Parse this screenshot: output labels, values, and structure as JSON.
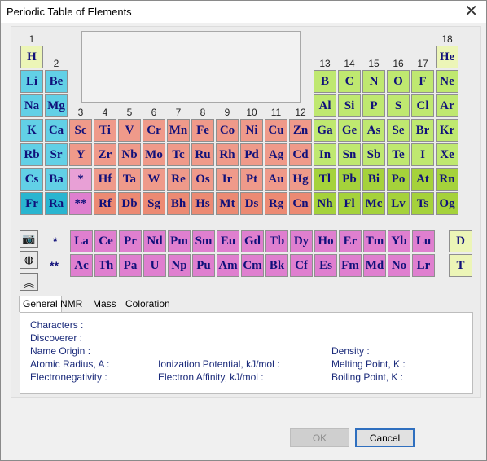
{
  "window": {
    "title": "Periodic Table of Elements",
    "close_symbol": "✕"
  },
  "colors": {
    "alkali": "#62d0e6",
    "alkali_dark": "#29b5d0",
    "transition": "#ef9a8a",
    "transition_dark": "#ec8a73",
    "main_group": "#bfe870",
    "main_group_dark": "#a5d23b",
    "s_edge": "#ecf5b7",
    "f_block": "#df7fcf",
    "f_marker": "#e8a0d6",
    "d_noble": "#ecf5b7"
  },
  "group_labels": [
    "1",
    "2",
    "3",
    "4",
    "5",
    "6",
    "7",
    "8",
    "9",
    "10",
    "11",
    "12",
    "13",
    "14",
    "15",
    "16",
    "17",
    "18"
  ],
  "elements": [
    {
      "sym": "H",
      "col": 1,
      "row": 1,
      "cls": "s_edge"
    },
    {
      "sym": "He",
      "col": 18,
      "row": 1,
      "cls": "s_edge"
    },
    {
      "sym": "Li",
      "col": 1,
      "row": 2,
      "cls": "alkali"
    },
    {
      "sym": "Be",
      "col": 2,
      "row": 2,
      "cls": "alkali"
    },
    {
      "sym": "B",
      "col": 13,
      "row": 2,
      "cls": "main_group"
    },
    {
      "sym": "C",
      "col": 14,
      "row": 2,
      "cls": "main_group"
    },
    {
      "sym": "N",
      "col": 15,
      "row": 2,
      "cls": "main_group"
    },
    {
      "sym": "O",
      "col": 16,
      "row": 2,
      "cls": "main_group"
    },
    {
      "sym": "F",
      "col": 17,
      "row": 2,
      "cls": "main_group"
    },
    {
      "sym": "Ne",
      "col": 18,
      "row": 2,
      "cls": "main_group"
    },
    {
      "sym": "Na",
      "col": 1,
      "row": 3,
      "cls": "alkali"
    },
    {
      "sym": "Mg",
      "col": 2,
      "row": 3,
      "cls": "alkali"
    },
    {
      "sym": "Al",
      "col": 13,
      "row": 3,
      "cls": "main_group"
    },
    {
      "sym": "Si",
      "col": 14,
      "row": 3,
      "cls": "main_group"
    },
    {
      "sym": "P",
      "col": 15,
      "row": 3,
      "cls": "main_group"
    },
    {
      "sym": "S",
      "col": 16,
      "row": 3,
      "cls": "main_group"
    },
    {
      "sym": "Cl",
      "col": 17,
      "row": 3,
      "cls": "main_group"
    },
    {
      "sym": "Ar",
      "col": 18,
      "row": 3,
      "cls": "main_group"
    },
    {
      "sym": "K",
      "col": 1,
      "row": 4,
      "cls": "alkali"
    },
    {
      "sym": "Ca",
      "col": 2,
      "row": 4,
      "cls": "alkali"
    },
    {
      "sym": "Sc",
      "col": 3,
      "row": 4,
      "cls": "transition"
    },
    {
      "sym": "Ti",
      "col": 4,
      "row": 4,
      "cls": "transition"
    },
    {
      "sym": "V",
      "col": 5,
      "row": 4,
      "cls": "transition"
    },
    {
      "sym": "Cr",
      "col": 6,
      "row": 4,
      "cls": "transition"
    },
    {
      "sym": "Mn",
      "col": 7,
      "row": 4,
      "cls": "transition"
    },
    {
      "sym": "Fe",
      "col": 8,
      "row": 4,
      "cls": "transition"
    },
    {
      "sym": "Co",
      "col": 9,
      "row": 4,
      "cls": "transition"
    },
    {
      "sym": "Ni",
      "col": 10,
      "row": 4,
      "cls": "transition"
    },
    {
      "sym": "Cu",
      "col": 11,
      "row": 4,
      "cls": "transition"
    },
    {
      "sym": "Zn",
      "col": 12,
      "row": 4,
      "cls": "transition"
    },
    {
      "sym": "Ga",
      "col": 13,
      "row": 4,
      "cls": "main_group"
    },
    {
      "sym": "Ge",
      "col": 14,
      "row": 4,
      "cls": "main_group"
    },
    {
      "sym": "As",
      "col": 15,
      "row": 4,
      "cls": "main_group"
    },
    {
      "sym": "Se",
      "col": 16,
      "row": 4,
      "cls": "main_group"
    },
    {
      "sym": "Br",
      "col": 17,
      "row": 4,
      "cls": "main_group"
    },
    {
      "sym": "Kr",
      "col": 18,
      "row": 4,
      "cls": "main_group"
    },
    {
      "sym": "Rb",
      "col": 1,
      "row": 5,
      "cls": "alkali"
    },
    {
      "sym": "Sr",
      "col": 2,
      "row": 5,
      "cls": "alkali"
    },
    {
      "sym": "Y",
      "col": 3,
      "row": 5,
      "cls": "transition"
    },
    {
      "sym": "Zr",
      "col": 4,
      "row": 5,
      "cls": "transition"
    },
    {
      "sym": "Nb",
      "col": 5,
      "row": 5,
      "cls": "transition"
    },
    {
      "sym": "Mo",
      "col": 6,
      "row": 5,
      "cls": "transition"
    },
    {
      "sym": "Tc",
      "col": 7,
      "row": 5,
      "cls": "transition"
    },
    {
      "sym": "Ru",
      "col": 8,
      "row": 5,
      "cls": "transition"
    },
    {
      "sym": "Rh",
      "col": 9,
      "row": 5,
      "cls": "transition"
    },
    {
      "sym": "Pd",
      "col": 10,
      "row": 5,
      "cls": "transition"
    },
    {
      "sym": "Ag",
      "col": 11,
      "row": 5,
      "cls": "transition"
    },
    {
      "sym": "Cd",
      "col": 12,
      "row": 5,
      "cls": "transition"
    },
    {
      "sym": "In",
      "col": 13,
      "row": 5,
      "cls": "main_group"
    },
    {
      "sym": "Sn",
      "col": 14,
      "row": 5,
      "cls": "main_group"
    },
    {
      "sym": "Sb",
      "col": 15,
      "row": 5,
      "cls": "main_group"
    },
    {
      "sym": "Te",
      "col": 16,
      "row": 5,
      "cls": "main_group"
    },
    {
      "sym": "I",
      "col": 17,
      "row": 5,
      "cls": "main_group"
    },
    {
      "sym": "Xe",
      "col": 18,
      "row": 5,
      "cls": "main_group"
    },
    {
      "sym": "Cs",
      "col": 1,
      "row": 6,
      "cls": "alkali"
    },
    {
      "sym": "Ba",
      "col": 2,
      "row": 6,
      "cls": "alkali"
    },
    {
      "sym": "*",
      "col": 3,
      "row": 6,
      "cls": "f_marker"
    },
    {
      "sym": "Hf",
      "col": 4,
      "row": 6,
      "cls": "transition"
    },
    {
      "sym": "Ta",
      "col": 5,
      "row": 6,
      "cls": "transition"
    },
    {
      "sym": "W",
      "col": 6,
      "row": 6,
      "cls": "transition"
    },
    {
      "sym": "Re",
      "col": 7,
      "row": 6,
      "cls": "transition"
    },
    {
      "sym": "Os",
      "col": 8,
      "row": 6,
      "cls": "transition"
    },
    {
      "sym": "Ir",
      "col": 9,
      "row": 6,
      "cls": "transition"
    },
    {
      "sym": "Pt",
      "col": 10,
      "row": 6,
      "cls": "transition"
    },
    {
      "sym": "Au",
      "col": 11,
      "row": 6,
      "cls": "transition"
    },
    {
      "sym": "Hg",
      "col": 12,
      "row": 6,
      "cls": "transition"
    },
    {
      "sym": "Tl",
      "col": 13,
      "row": 6,
      "cls": "main_group_dark"
    },
    {
      "sym": "Pb",
      "col": 14,
      "row": 6,
      "cls": "main_group_dark"
    },
    {
      "sym": "Bi",
      "col": 15,
      "row": 6,
      "cls": "main_group_dark"
    },
    {
      "sym": "Po",
      "col": 16,
      "row": 6,
      "cls": "main_group_dark"
    },
    {
      "sym": "At",
      "col": 17,
      "row": 6,
      "cls": "main_group_dark"
    },
    {
      "sym": "Rn",
      "col": 18,
      "row": 6,
      "cls": "main_group_dark"
    },
    {
      "sym": "Fr",
      "col": 1,
      "row": 7,
      "cls": "alkali_dark"
    },
    {
      "sym": "Ra",
      "col": 2,
      "row": 7,
      "cls": "alkali_dark"
    },
    {
      "sym": "**",
      "col": 3,
      "row": 7,
      "cls": "f_block"
    },
    {
      "sym": "Rf",
      "col": 4,
      "row": 7,
      "cls": "transition_dark"
    },
    {
      "sym": "Db",
      "col": 5,
      "row": 7,
      "cls": "transition_dark"
    },
    {
      "sym": "Sg",
      "col": 6,
      "row": 7,
      "cls": "transition_dark"
    },
    {
      "sym": "Bh",
      "col": 7,
      "row": 7,
      "cls": "transition_dark"
    },
    {
      "sym": "Hs",
      "col": 8,
      "row": 7,
      "cls": "transition_dark"
    },
    {
      "sym": "Mt",
      "col": 9,
      "row": 7,
      "cls": "transition_dark"
    },
    {
      "sym": "Ds",
      "col": 10,
      "row": 7,
      "cls": "transition_dark"
    },
    {
      "sym": "Rg",
      "col": 11,
      "row": 7,
      "cls": "transition_dark"
    },
    {
      "sym": "Cn",
      "col": 12,
      "row": 7,
      "cls": "transition_dark"
    },
    {
      "sym": "Nh",
      "col": 13,
      "row": 7,
      "cls": "main_group_dark"
    },
    {
      "sym": "Fl",
      "col": 14,
      "row": 7,
      "cls": "main_group_dark"
    },
    {
      "sym": "Mc",
      "col": 15,
      "row": 7,
      "cls": "main_group_dark"
    },
    {
      "sym": "Lv",
      "col": 16,
      "row": 7,
      "cls": "main_group_dark"
    },
    {
      "sym": "Ts",
      "col": 17,
      "row": 7,
      "cls": "main_group_dark"
    },
    {
      "sym": "Og",
      "col": 18,
      "row": 7,
      "cls": "main_group_dark"
    }
  ],
  "lanthanides": {
    "label": "*",
    "symbols": [
      "La",
      "Ce",
      "Pr",
      "Nd",
      "Pm",
      "Sm",
      "Eu",
      "Gd",
      "Tb",
      "Dy",
      "Ho",
      "Er",
      "Tm",
      "Yb",
      "Lu"
    ]
  },
  "actinides": {
    "label": "**",
    "symbols": [
      "Ac",
      "Th",
      "Pa",
      "U",
      "Np",
      "Pu",
      "Am",
      "Cm",
      "Bk",
      "Cf",
      "Es",
      "Fm",
      "Md",
      "No",
      "Lr"
    ]
  },
  "isotopes": [
    "D",
    "T"
  ],
  "tools": [
    {
      "name": "camera-icon",
      "glyph": "📷"
    },
    {
      "name": "globe-icon",
      "glyph": "◍"
    },
    {
      "name": "double-chevron-up-icon",
      "glyph": "︽"
    }
  ],
  "tabs": [
    {
      "name": "tab-general",
      "label": "General",
      "active": true
    },
    {
      "name": "tab-nmr",
      "label": "NMR",
      "active": false
    },
    {
      "name": "tab-mass",
      "label": "Mass",
      "active": false
    },
    {
      "name": "tab-coloration",
      "label": "Coloration",
      "active": false
    }
  ],
  "general": {
    "characters": "Characters :",
    "discoverer": "Discoverer :",
    "name_origin": "Name Origin :",
    "density": "Density :",
    "atomic_radius": "Atomic Radius, A :",
    "ionization": "Ionization Potential, kJ/mol :",
    "melting": "Melting Point, K :",
    "electronegativity": "Electronegativity :",
    "electron_affinity": "Electron Affinity, kJ/mol :",
    "boiling": "Boiling Point, K :"
  },
  "buttons": {
    "ok": "OK",
    "cancel": "Cancel"
  }
}
